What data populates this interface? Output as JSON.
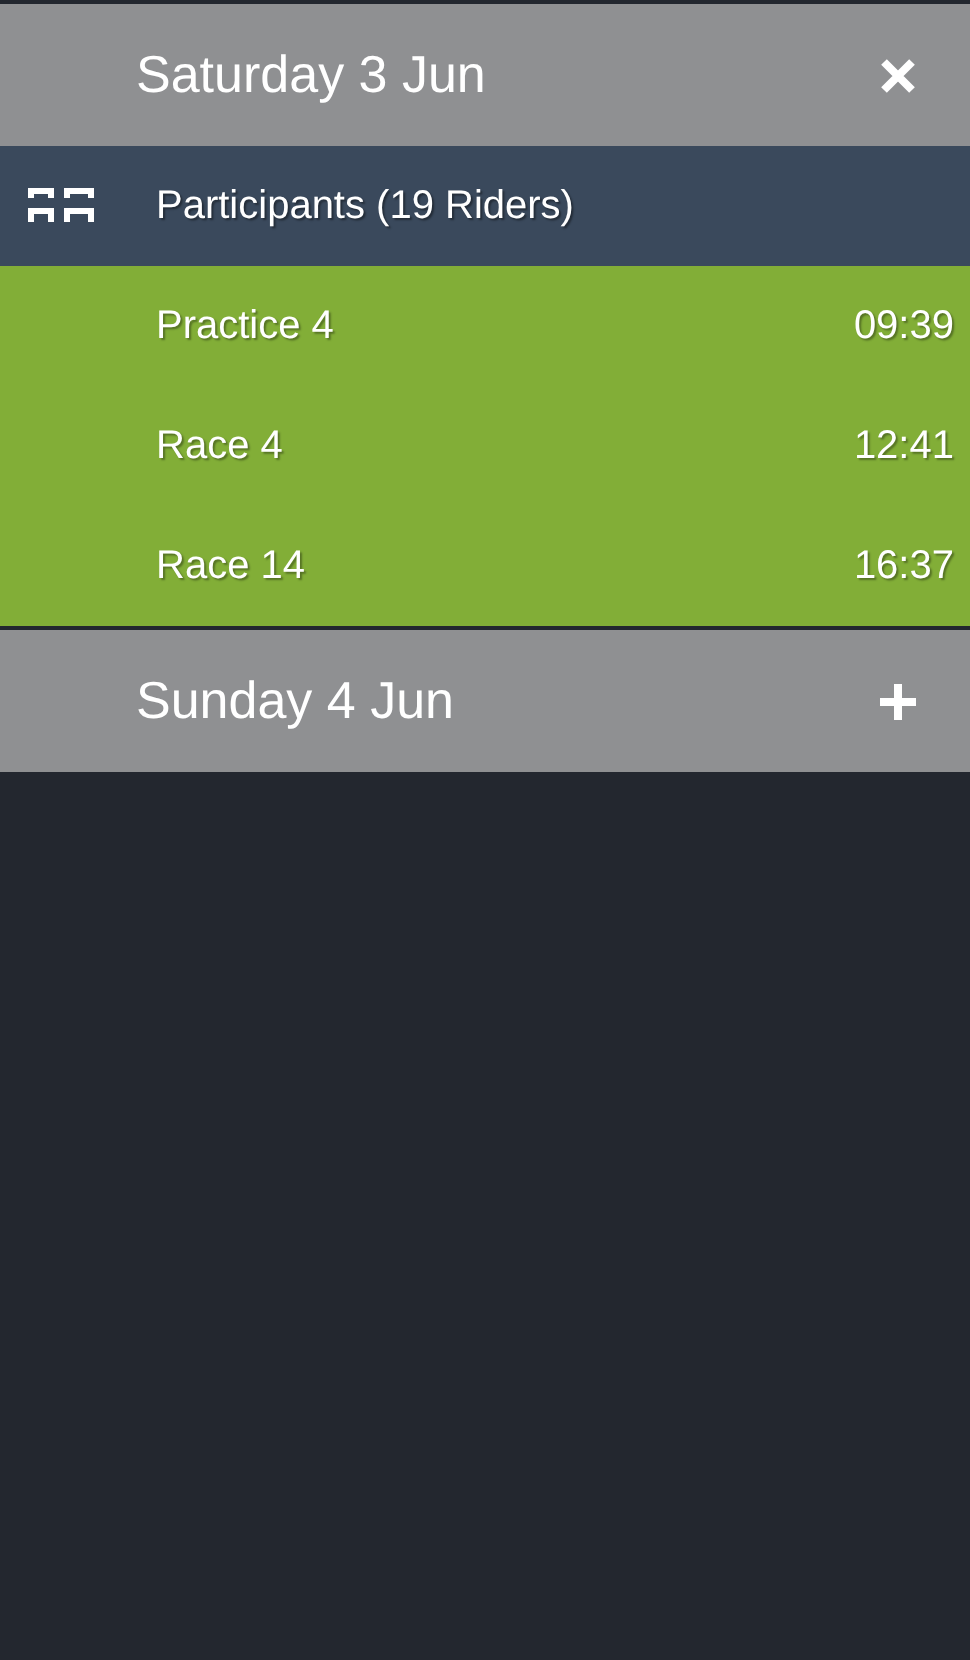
{
  "days": [
    {
      "title": "Saturday 3 Jun",
      "expanded": true,
      "participants": "Participants (19 Riders)",
      "sessions": [
        {
          "name": "Practice 4",
          "time": "09:39"
        },
        {
          "name": "Race 4",
          "time": "12:41"
        },
        {
          "name": "Race 14",
          "time": "16:37"
        }
      ]
    },
    {
      "title": "Sunday 4 Jun",
      "expanded": false
    }
  ]
}
